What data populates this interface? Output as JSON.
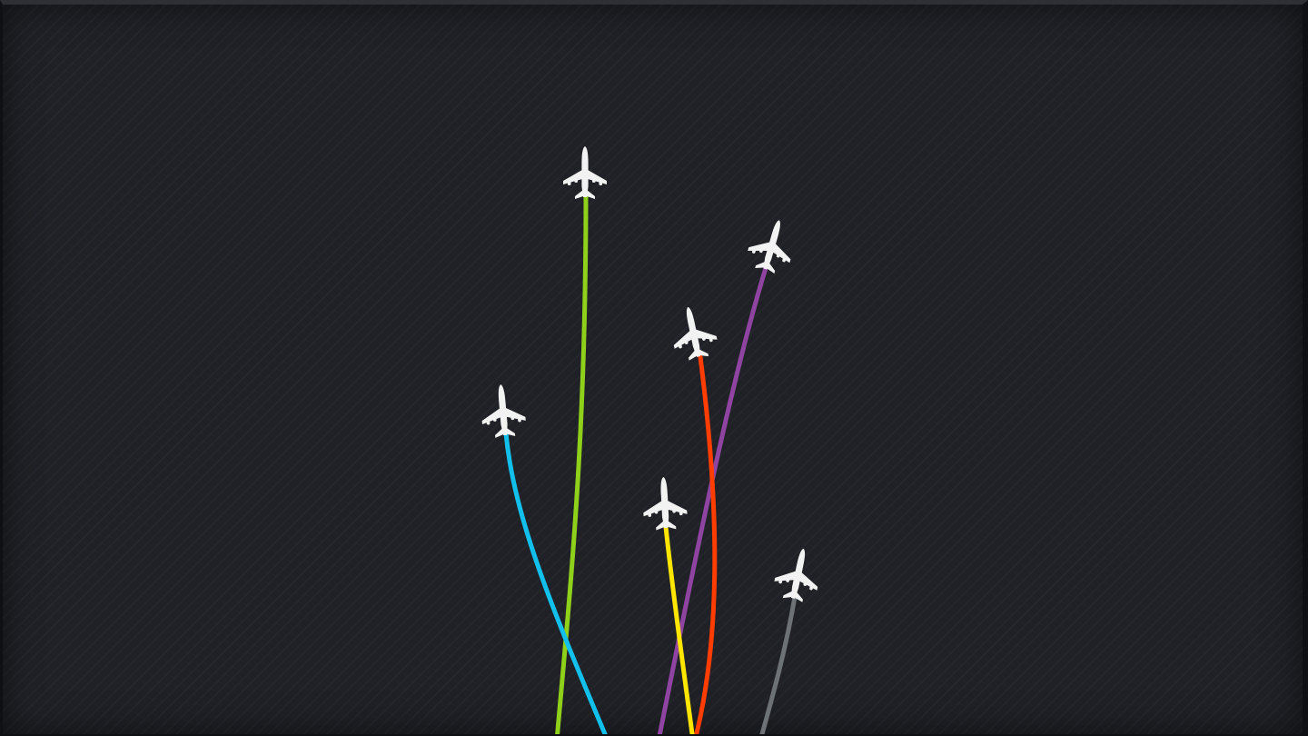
{
  "colors": {
    "background": "#1f2126",
    "plane": "#f2f2f2"
  },
  "flights": [
    {
      "name": "green",
      "color": "#8fd11a"
    },
    {
      "name": "purple",
      "color": "#8e44a0"
    },
    {
      "name": "red",
      "color": "#ff3d00"
    },
    {
      "name": "blue",
      "color": "#13c0ec"
    },
    {
      "name": "yellow",
      "color": "#ffe600"
    },
    {
      "name": "gray",
      "color": "#6d7277"
    }
  ]
}
